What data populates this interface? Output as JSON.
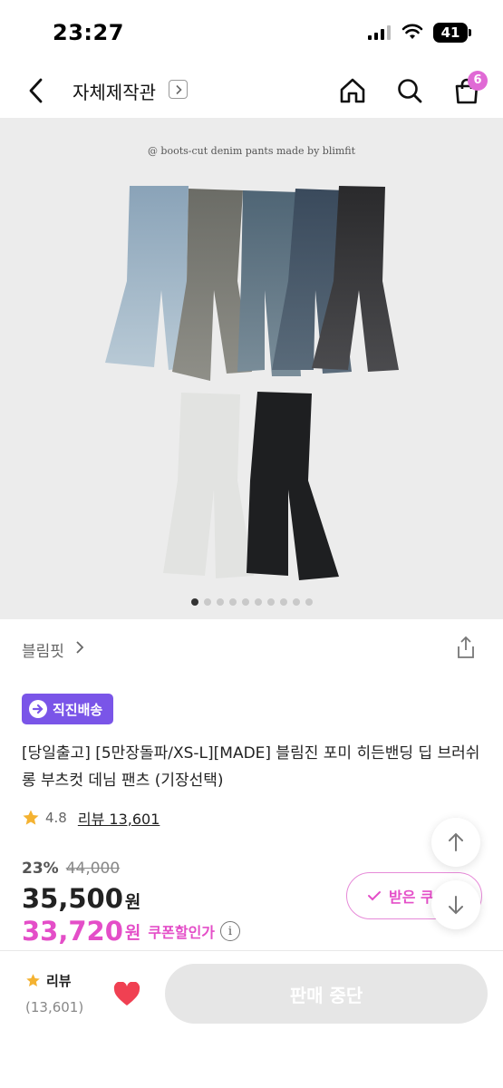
{
  "status_bar": {
    "time": "23:27",
    "battery": "41"
  },
  "nav": {
    "title": "자체제작관",
    "cart_count": "6"
  },
  "product_image": {
    "caption": "@ boots-cut denim pants made by blimfit",
    "slide_count": 10,
    "active_slide": 1
  },
  "brand": {
    "name": "블림핏"
  },
  "delivery_badge": {
    "label": "직진배송"
  },
  "product": {
    "title": "[당일출고] [5만장돌파/XS-L][MADE] 블림진 포미 히든밴딩 딥 브러쉬 롱 부츠컷 데님 팬츠 (기장선택)"
  },
  "rating": {
    "value": "4.8",
    "review_label": "리뷰 13,601"
  },
  "price": {
    "discount_rate": "23%",
    "original": "44,000",
    "sale": "35,500",
    "sale_unit": "원",
    "coupon_price": "33,720",
    "coupon_unit": "원",
    "coupon_label": "쿠폰할인가",
    "info_glyph": "i"
  },
  "coupon_button": {
    "label": "받은 쿠"
  },
  "bottom_bar": {
    "review_label": "리뷰",
    "review_count": "(13,601)",
    "buy_label": "판매 중단"
  },
  "colors": {
    "accent_pink": "#e44ec8",
    "badge_purple": "#7a55e8",
    "heart_red": "#f04052"
  }
}
